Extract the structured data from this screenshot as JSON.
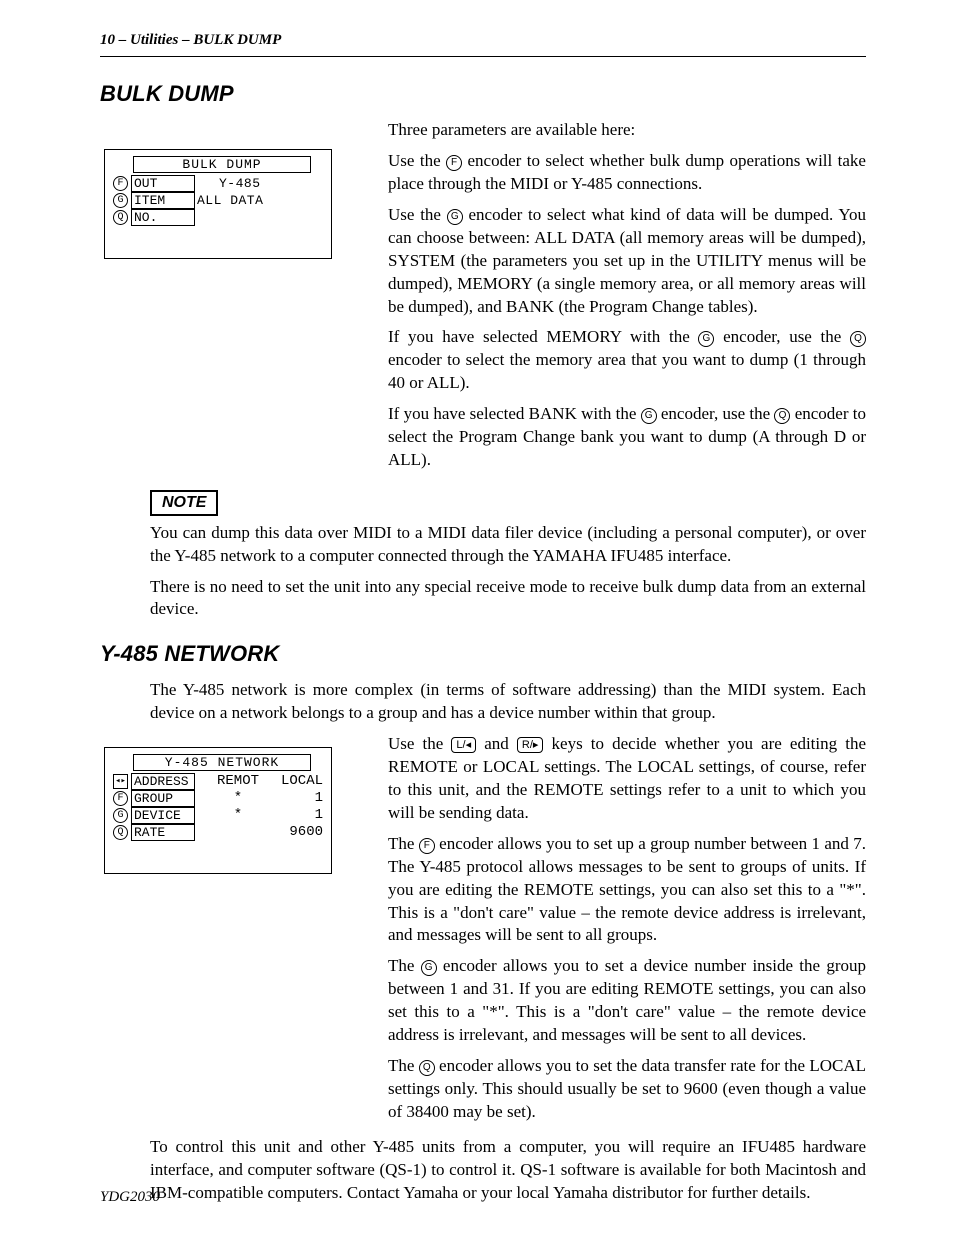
{
  "header": {
    "running": "10 – Utilities – BULK DUMP"
  },
  "section1": {
    "title": "BULK DUMP",
    "lcd": {
      "title": "BULK DUMP",
      "rows": [
        {
          "enc": "F",
          "label": "OUT",
          "val": "Y-485"
        },
        {
          "enc": "G",
          "label": "ITEM",
          "val": "ALL DATA"
        },
        {
          "enc": "Q",
          "label": "NO.",
          "val": ""
        }
      ]
    },
    "p1": "Three parameters are available here:",
    "p2a": "Use the ",
    "p2b": " encoder to select whether bulk dump operations will take place through the MIDI or Y-485 connections.",
    "p3a": "Use the ",
    "p3b": " encoder to select what kind of data will be dumped. You can choose between: ALL DATA (all memory areas will be dumped), SYSTEM (the parameters you set up in the UTILITY menus will be dumped), MEMORY (a single memory area, or all memory areas will be dumped), and BANK (the Program Change tables).",
    "p4a": "If you have selected MEMORY with the ",
    "p4b": " encoder, use the ",
    "p4c": " encoder to select the memory area that you want to dump (1 through 40 or ALL).",
    "p5a": "If you have selected BANK with the ",
    "p5b": " encoder, use the ",
    "p5c": " encoder to select the Program Change bank you want to dump (A through D or ALL).",
    "noteLabel": "NOTE",
    "note1": "You can dump this data over MIDI to a MIDI data filer device (including a personal computer), or over the Y-485 network to a computer connected through the YAMAHA IFU485 interface.",
    "note2": "There is no need to set the unit into any special receive mode to receive bulk dump data from an external device."
  },
  "section2": {
    "title": "Y-485 NETWORK",
    "intro": "The Y-485 network is more complex (in terms of software addressing) than the MIDI system. Each device on a network belongs to a group and has a device number within that group.",
    "lcd": {
      "title": "Y-485 NETWORK",
      "hdrLabel": "ADDRESS",
      "hdrC1": "REMOT",
      "hdrC2": "LOCAL",
      "rows": [
        {
          "enc": "F",
          "label": "GROUP",
          "c1": "*",
          "c2": "1"
        },
        {
          "enc": "G",
          "label": "DEVICE",
          "c1": "*",
          "c2": "1"
        },
        {
          "enc": "Q",
          "label": "RATE",
          "c1": "",
          "c2": "9600"
        }
      ]
    },
    "p1a": "Use the ",
    "p1b": " and ",
    "p1c": " keys to decide whether you are editing the REMOTE or LOCAL settings. The LOCAL settings, of course, refer to this unit, and the REMOTE settings refer to a unit to which you will be sending data.",
    "key1": "L/◂",
    "key2": "R/▸",
    "p2a": "The ",
    "p2b": " encoder allows you to set up a group number between 1 and 7. The Y-485 protocol allows messages to be sent to groups of units. If you are editing the REMOTE settings, you can also set this to a \"*\". This is a \"don't care\" value – the remote device address is irrelevant, and messages will be sent to all groups.",
    "p3a": "The ",
    "p3b": " encoder allows you to set a device number inside the group between 1 and 31. If you are editing REMOTE settings, you can also set this to a \"*\". This is a \"don't care\" value – the remote device address is irrelevant, and messages will be sent to all devices.",
    "p4a": "The ",
    "p4b": " encoder allows you to set the data transfer rate for the LOCAL settings only. This should usually be set to 9600 (even though a value of 38400 may be set).",
    "outro": "To control this unit and other Y-485 units from a computer, you will require an IFU485 hardware interface, and computer software (QS-1) to control it. QS-1 software is available for both Macintosh and IBM-compatible computers. Contact Yamaha or your local Yamaha distributor for further details."
  },
  "encoders": {
    "F": "F",
    "G": "G",
    "Q": "Q"
  },
  "footer": "YDG2030"
}
